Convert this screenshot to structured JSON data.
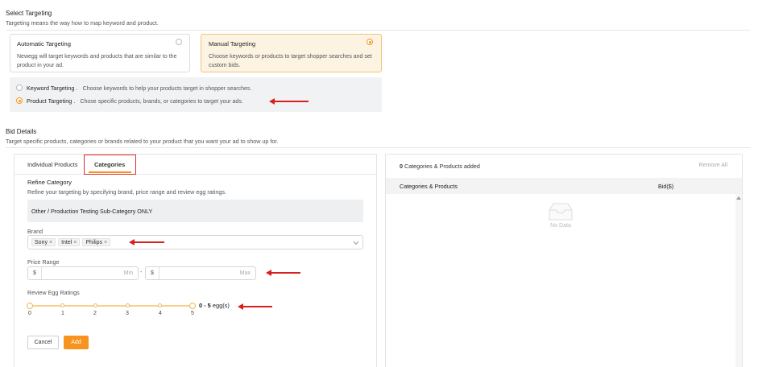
{
  "select_targeting": {
    "title": "Select Targeting",
    "subtitle": "Targeting means the way how to map keyword and product."
  },
  "automatic": {
    "title": "Automatic Targeting",
    "description": "Newegg will target keywords and products that are similar to the product in your ad."
  },
  "manual": {
    "title": "Manual Targeting",
    "description": "Choose keywords or products to target shopper searches and set custom bids."
  },
  "keyword_targeting": {
    "label": "Keyword Targeting .",
    "description": "Choose keywords to help your products target in shopper searches."
  },
  "product_targeting": {
    "label": "Product Targeting .",
    "description": "Chose specific products, brands, or categories to target your ads."
  },
  "bid_details": {
    "title": "Bid Details",
    "subtitle": "Target specific products, categories or brands related to your product that you want your ad to show up for."
  },
  "tabs": {
    "individual": "Individual Products",
    "categories": "Categories"
  },
  "refine": {
    "title": "Refine Category",
    "subtitle": "Refine your targeting by specifying brand, price range and review egg ratings.",
    "category": "Other / Production Testing Sub-Category ONLY"
  },
  "brand": {
    "label": "Brand",
    "chips": [
      "Sony",
      "Intel",
      "Philips"
    ],
    "remove_glyph": "×"
  },
  "price": {
    "label": "Price Range",
    "currency": "$",
    "min_placeholder": "Min",
    "max_placeholder": "Max",
    "separator": "-"
  },
  "rating": {
    "label": "Review Egg Ratings",
    "ticks": [
      "0",
      "1",
      "2",
      "3",
      "4",
      "5"
    ],
    "range_value": "0 - 5",
    "range_unit": "egg(s)",
    "selected_min": 0,
    "selected_max": 5
  },
  "buttons": {
    "cancel": "Cancel",
    "add": "Add"
  },
  "summary": {
    "count": "0",
    "count_text": "Categories & Products added",
    "remove_all": "Remove All",
    "col_items": "Categories & Products",
    "col_bid": "Bid($)",
    "empty": "No Data"
  },
  "colors": {
    "accent": "#f7931e",
    "annotation": "#d92020"
  }
}
